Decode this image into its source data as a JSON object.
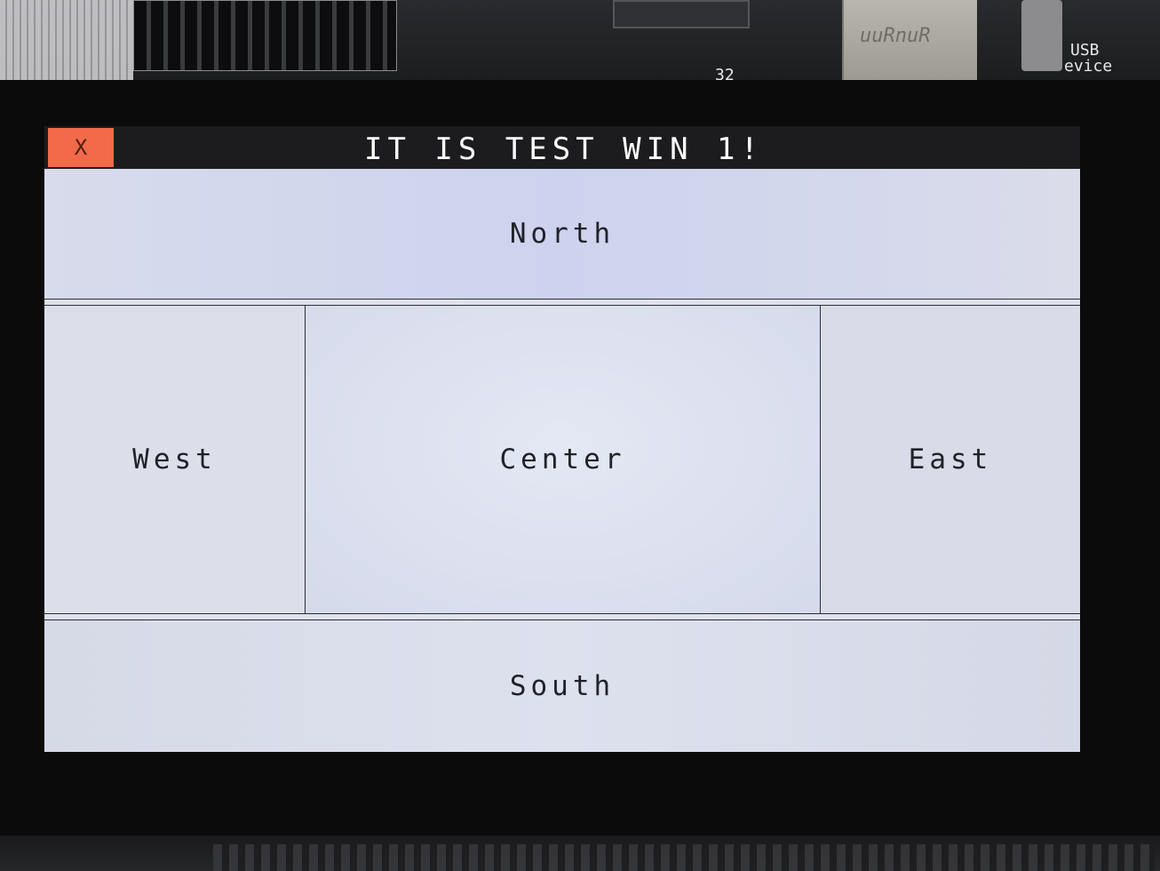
{
  "window": {
    "title": "IT IS TEST WIN 1!",
    "close_label": "X"
  },
  "layout_panels": {
    "north": "North",
    "west": "West",
    "center": "Center",
    "east": "East",
    "south": "South"
  },
  "board_labels": {
    "usb_label_line1": "USB",
    "usb_label_line2": "evice",
    "sd_brand": "uuRnuR",
    "chip_marking": "32"
  },
  "colors": {
    "close_button": "#f26a4a",
    "client_background": "#dfe2ee",
    "title_bar": "#1c1c1e",
    "title_text": "#ffffff"
  }
}
